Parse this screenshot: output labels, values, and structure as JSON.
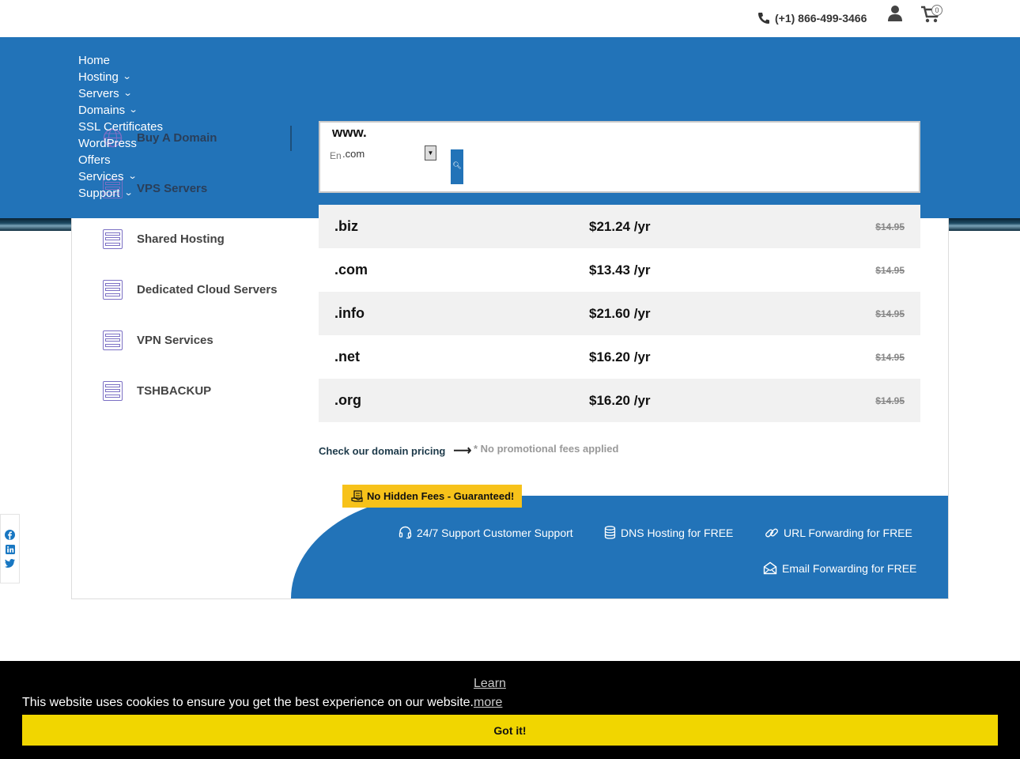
{
  "topbar": {
    "phone": "(+1) 866-499-3466",
    "cart_count": "0",
    "icons": [
      "phone-icon",
      "user-icon",
      "cart-icon"
    ]
  },
  "nav": {
    "items": [
      {
        "label": "Home",
        "has_dropdown": false
      },
      {
        "label": "Hosting",
        "has_dropdown": true
      },
      {
        "label": "Servers",
        "has_dropdown": true
      },
      {
        "label": "Domains",
        "has_dropdown": true
      },
      {
        "label": "SSL Certificates",
        "has_dropdown": false
      },
      {
        "label": "WordPress",
        "has_dropdown": false
      },
      {
        "label": "Offers",
        "has_dropdown": false
      },
      {
        "label": "Services",
        "has_dropdown": true
      },
      {
        "label": "Support",
        "has_dropdown": true
      }
    ]
  },
  "sidebar": {
    "items": [
      {
        "label": "Buy A Domain",
        "icon": "globe-icon"
      },
      {
        "label": "VPS Servers",
        "icon": "server-icon"
      },
      {
        "label": "Shared Hosting",
        "icon": "server-icon"
      },
      {
        "label": "Dedicated Cloud Servers",
        "icon": "server-icon"
      },
      {
        "label": "VPN Services",
        "icon": "server-icon"
      },
      {
        "label": "TSHBACKUP",
        "icon": "server-icon"
      }
    ]
  },
  "search": {
    "prefix": "www.",
    "placeholder": "Enter domain",
    "selected_tld": ".com"
  },
  "pricing": {
    "rows": [
      {
        "tld": ".biz",
        "price": "$21.24 /yr",
        "old_price": "$14.95"
      },
      {
        "tld": ".com",
        "price": "$13.43 /yr",
        "old_price": "$14.95"
      },
      {
        "tld": ".info",
        "price": "$21.60 /yr",
        "old_price": "$14.95"
      },
      {
        "tld": ".net",
        "price": "$16.20 /yr",
        "old_price": "$14.95"
      },
      {
        "tld": ".org",
        "price": "$16.20 /yr",
        "old_price": "$14.95"
      }
    ],
    "link": "Check our domain pricing",
    "note": "* No promotional fees applied"
  },
  "features": {
    "badge": "No Hidden Fees - Guaranteed!",
    "items": [
      {
        "label": "24/7 Support Customer Support",
        "icon": "headset-icon"
      },
      {
        "label": "DNS Hosting for FREE",
        "icon": "database-icon"
      },
      {
        "label": "URL Forwarding for FREE",
        "icon": "link-icon"
      },
      {
        "label": "Email Forwarding for FREE",
        "icon": "envelope-icon"
      }
    ]
  },
  "social": [
    "facebook-icon",
    "linkedin-icon",
    "twitter-icon"
  ],
  "cookie": {
    "learn": "Learn",
    "message": "This website uses cookies to ensure you get the best experience on our website.",
    "more": "more",
    "button": "Got it!"
  },
  "colors": {
    "brand_blue": "#2273b8",
    "badge_yellow": "#f7c21a",
    "cookie_button": "#f1d600",
    "server_icon": "#7b6fc4"
  }
}
